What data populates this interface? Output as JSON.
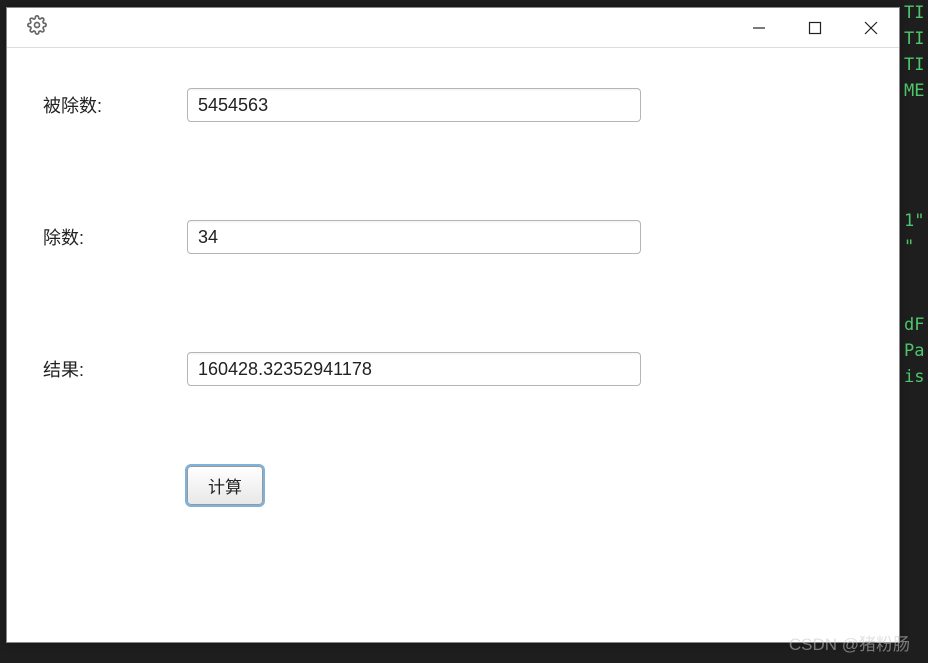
{
  "titlebar": {
    "icon": "gear-icon"
  },
  "form": {
    "dividend_label": "被除数:",
    "dividend_value": "5454563",
    "divisor_label": "除数:",
    "divisor_value": "34",
    "result_label": "结果:",
    "result_value": "160428.32352941178",
    "calculate_button": "计算"
  },
  "watermark": "CSDN @猪粉肠"
}
